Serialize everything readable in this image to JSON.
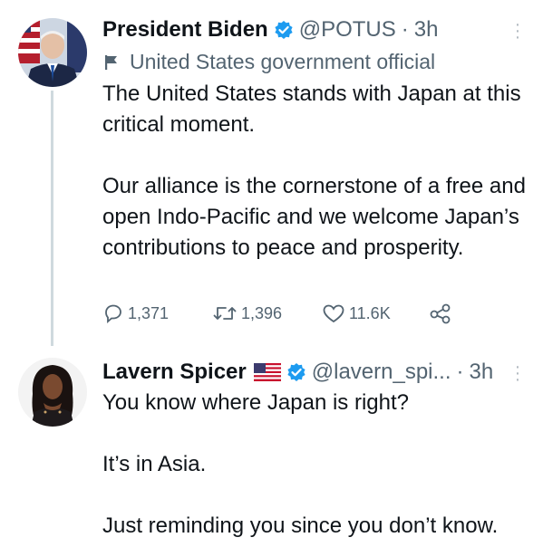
{
  "tweet1": {
    "name": "President Biden",
    "handle": "@POTUS",
    "separator": "·",
    "time": "3h",
    "label": "United States government official",
    "text": "The United States stands with Japan at this critical moment.\n\nOur alliance is the cornerstone of a free and open Indo-Pacific and we welcome Japan’s contributions to peace and prosperity.",
    "replies": "1,371",
    "retweets": "1,396",
    "likes": "11.6K"
  },
  "tweet2": {
    "name": "Lavern Spicer",
    "handle": "@lavern_spi...",
    "separator": "·",
    "time": "3h",
    "text": "You know where Japan is right?\n\nIt’s in Asia.\n\nJust reminding you since you don’t know."
  },
  "colors": {
    "verified": "#1d9bf0",
    "secondary_text": "#536471",
    "thread_line": "#cfd9de"
  },
  "icons": [
    "verified-badge-icon",
    "flag-icon",
    "reply-icon",
    "retweet-icon",
    "like-icon",
    "share-icon",
    "more-icon",
    "us-flag-emoji"
  ]
}
